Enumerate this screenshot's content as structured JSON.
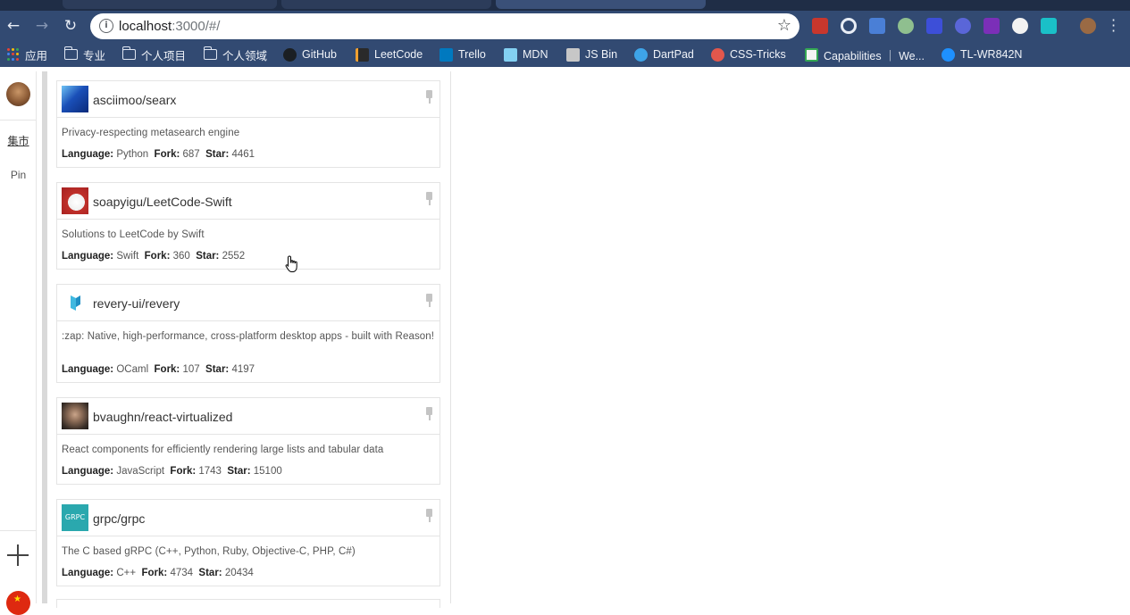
{
  "browser": {
    "url_host": "localhost",
    "url_rest": ":3000/#/",
    "colors": {
      "frame": "#324a72",
      "tabstrip": "#1f2d46"
    },
    "extensions": [
      "extension-red-icon",
      "extension-target-icon",
      "extension-translate-icon",
      "extension-green-dot-icon",
      "extension-blue-icon",
      "extension-shield-icon",
      "extension-rp-icon",
      "extension-white-icon",
      "extension-cyan-icon",
      "profile-icon"
    ]
  },
  "bookmarks": [
    {
      "label": "应用",
      "icon": "apps-grid-icon"
    },
    {
      "label": "专业",
      "icon": "folder-icon"
    },
    {
      "label": "个人项目",
      "icon": "folder-icon"
    },
    {
      "label": "个人领域",
      "icon": "folder-icon"
    },
    {
      "label": "GitHub",
      "icon": "github-icon"
    },
    {
      "label": "LeetCode",
      "icon": "leetcode-icon"
    },
    {
      "label": "Trello",
      "icon": "trello-icon"
    },
    {
      "label": "MDN",
      "icon": "mdn-icon"
    },
    {
      "label": "JS Bin",
      "icon": "jsbin-icon"
    },
    {
      "label": "DartPad",
      "icon": "dartpad-icon"
    },
    {
      "label": "CSS-Tricks",
      "icon": "css-tricks-icon"
    },
    {
      "label": "Capabilities ｜ We...",
      "icon": "capabilities-icon"
    },
    {
      "label": "TL-WR842N",
      "icon": "tp-link-icon"
    }
  ],
  "sidebar": {
    "items": [
      {
        "label": "集市",
        "active": true
      },
      {
        "label": "Pin",
        "active": false
      }
    ]
  },
  "repos": [
    {
      "name": "asciimoo/searx",
      "description": "Privacy-respecting metasearch engine",
      "language": "Python",
      "fork": "687",
      "star": "4461",
      "avatar": "sonic-avatar"
    },
    {
      "name": "soapyigu/LeetCode-Swift",
      "description": "Solutions to LeetCode by Swift",
      "language": "Swift",
      "fork": "360",
      "star": "2552",
      "avatar": "baymax-avatar"
    },
    {
      "name": "revery-ui/revery",
      "description": ":zap: Native, high-performance, cross-platform desktop apps - built with Reason!",
      "language": "OCaml",
      "fork": "107",
      "star": "4197",
      "avatar": "revery-logo"
    },
    {
      "name": "bvaughn/react-virtualized",
      "description": "React components for efficiently rendering large lists and tabular data",
      "language": "JavaScript",
      "fork": "1743",
      "star": "15100",
      "avatar": "person-avatar"
    },
    {
      "name": "grpc/grpc",
      "description": "The C based gRPC (C++, Python, Ruby, Objective-C, PHP, C#)",
      "language": "C++",
      "fork": "4734",
      "star": "20434",
      "avatar": "grpc-logo",
      "avatar_text": "GRPC"
    }
  ],
  "labels": {
    "language": "Language:",
    "fork": "Fork:",
    "star": "Star:"
  }
}
